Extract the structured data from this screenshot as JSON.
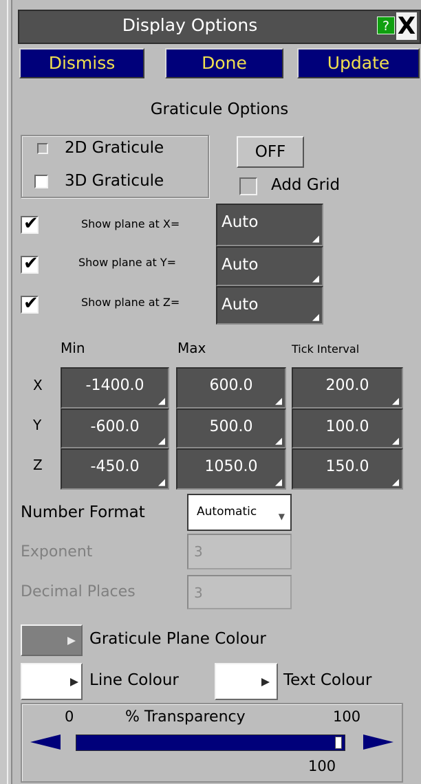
{
  "window": {
    "title": "Display Options",
    "help_icon": "?",
    "close_icon": "X"
  },
  "buttons": {
    "dismiss": "Dismiss",
    "done": "Done",
    "update": "Update"
  },
  "graticule": {
    "section_title": "Graticule Options",
    "option_2d": "2D Graticule",
    "option_3d": "3D Graticule",
    "toggle_label": "OFF",
    "add_grid": "Add Grid"
  },
  "planes": [
    {
      "label": "Show plane at X=",
      "value": "Auto",
      "checked": true
    },
    {
      "label": "Show plane at Y=",
      "value": "Auto",
      "checked": true
    },
    {
      "label": "Show plane at Z=",
      "value": "Auto",
      "checked": true
    }
  ],
  "ranges": {
    "headers": {
      "min": "Min",
      "max": "Max",
      "tick": "Tick Interval"
    },
    "rows": [
      {
        "axis": "X",
        "min": "-1400.0",
        "max": "600.0",
        "tick": "200.0"
      },
      {
        "axis": "Y",
        "min": "-600.0",
        "max": "500.0",
        "tick": "100.0"
      },
      {
        "axis": "Z",
        "min": "-450.0",
        "max": "1050.0",
        "tick": "150.0"
      }
    ]
  },
  "format": {
    "label": "Number Format",
    "selected": "Automatic",
    "exponent_label": "Exponent",
    "exponent_value": "3",
    "decimal_label": "Decimal Places",
    "decimal_value": "3"
  },
  "colours": {
    "plane_label": "Graticule Plane Colour",
    "plane_colour": "#808080",
    "line_label": "Line Colour",
    "line_colour": "#ffffff",
    "text_label": "Text Colour",
    "text_colour": "#ffffff"
  },
  "transparency": {
    "min_label": "0",
    "title": "% Transparency",
    "max_label": "100",
    "value": "100",
    "fraction": 1.0
  },
  "theme": {
    "accent_button_bg": "#00007a",
    "accent_button_text": "#f0e050",
    "field_bg": "#525252",
    "panel_bg": "#bdbdbd"
  }
}
